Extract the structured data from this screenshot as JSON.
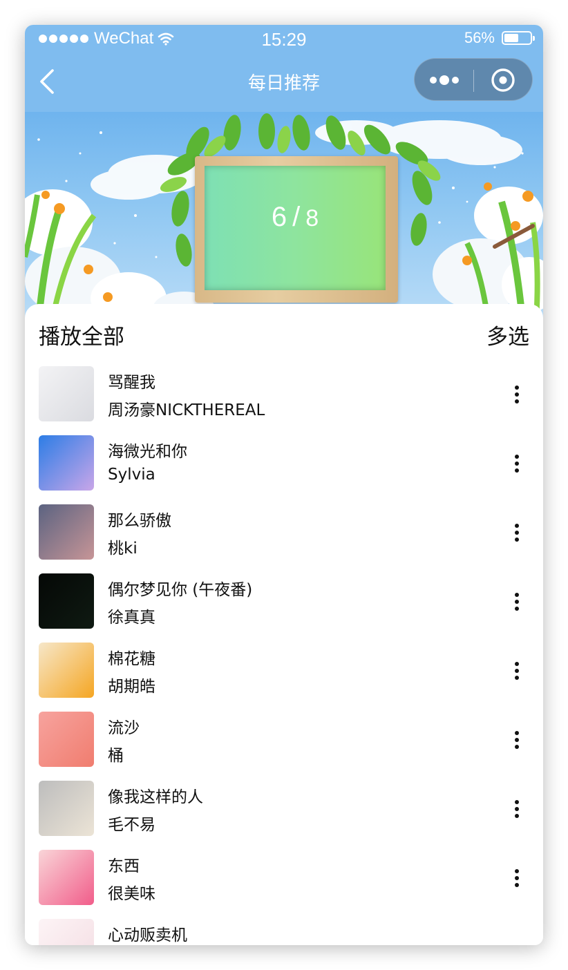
{
  "status_bar": {
    "carrier": "WeChat",
    "time": "15:29",
    "battery_percent": "56%",
    "battery_level": 0.56,
    "signal_dots": 5
  },
  "nav": {
    "title": "每日推荐",
    "back_icon": "chevron-left-icon",
    "more_icon": "more-dots-icon",
    "close_icon": "target-circle-icon"
  },
  "banner": {
    "current": "6",
    "separator": "/",
    "total": "8"
  },
  "list_header": {
    "play_all": "播放全部",
    "multi_select": "多选"
  },
  "songs": [
    {
      "title": "骂醒我",
      "artist": "周汤豪NICKTHEREAL",
      "cover_colors": [
        "#f3f3f5",
        "#dadbe0"
      ]
    },
    {
      "title": "海微光和你",
      "artist": "Sylvia",
      "cover_colors": [
        "#2c7de6",
        "#c9a6e8"
      ]
    },
    {
      "title": "那么骄傲",
      "artist": "桃ki",
      "cover_colors": [
        "#5b6381",
        "#c79597"
      ]
    },
    {
      "title": "偶尔梦见你 (午夜番)",
      "artist": "徐真真",
      "cover_colors": [
        "#050806",
        "#0f1a12"
      ]
    },
    {
      "title": "棉花糖",
      "artist": "胡期皓",
      "cover_colors": [
        "#f6e7c9",
        "#f5a623"
      ]
    },
    {
      "title": "流沙",
      "artist": "桶",
      "cover_colors": [
        "#f7a39e",
        "#f07d6f"
      ]
    },
    {
      "title": "像我这样的人",
      "artist": "毛不易",
      "cover_colors": [
        "#bdbdbd",
        "#ece4d6"
      ]
    },
    {
      "title": "东西",
      "artist": "很美味",
      "cover_colors": [
        "#f9d5d8",
        "#f15d8a"
      ]
    },
    {
      "title": "心动贩卖机",
      "artist": "",
      "cover_colors": [
        "#fdf4f6",
        "#f3dce2"
      ]
    }
  ],
  "colors": {
    "nav_background": "#7fbcef",
    "capsule_background": "#5f88ad",
    "text_primary": "#111111"
  }
}
